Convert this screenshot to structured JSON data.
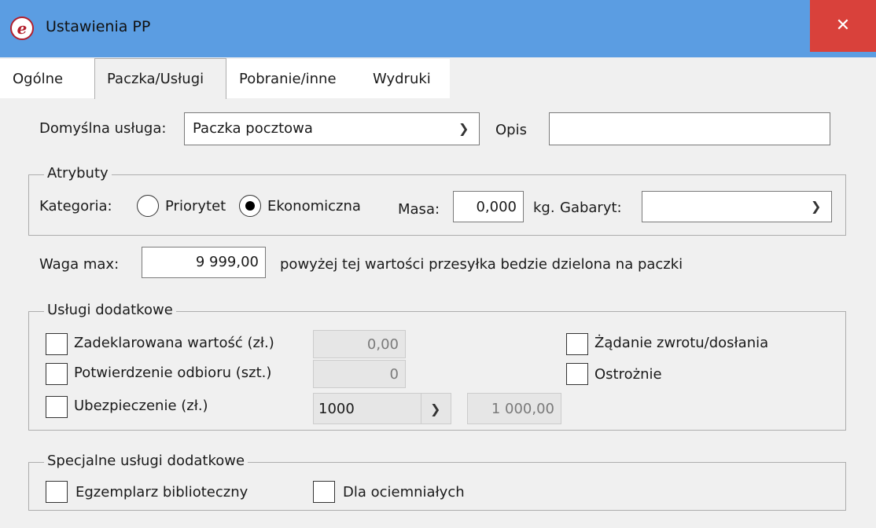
{
  "window": {
    "title": "Ustawienia PP",
    "close_glyph": "✕",
    "titlebar_color": "#5b9de2",
    "close_color": "#d9413b"
  },
  "tabs": [
    {
      "label": "Ogólne"
    },
    {
      "label": "Paczka/Usługi"
    },
    {
      "label": "Pobranie/inne"
    },
    {
      "label": "Wydruki"
    }
  ],
  "active_tab": "Paczka/Usługi",
  "main": {
    "default_service_label": "Domyślna usługa:",
    "default_service_value": "Paczka pocztowa",
    "description_label": "Opis",
    "description_value": ""
  },
  "attributes": {
    "legend": "Atrybuty",
    "category_label": "Kategoria:",
    "options": [
      "Priorytet",
      "Ekonomiczna"
    ],
    "selected": "Ekonomiczna",
    "mass_label": "Masa:",
    "mass_value": "0,000",
    "mass_unit": "kg.",
    "size_label": "Gabaryt:",
    "size_value": ""
  },
  "max_weight": {
    "label": "Waga max:",
    "value": "9 999,00",
    "note": "powyżej tej wartości przesyłka bedzie dzielona na paczki"
  },
  "additional_services": {
    "legend": "Usługi dodatkowe",
    "declared_value_label": "Zadeklarowana wartość (zł.)",
    "declared_value": "0,00",
    "receipt_confirmation_label": "Potwierdzenie odbioru (szt.)",
    "receipt_confirmation_value": "0",
    "insurance_label": "Ubezpieczenie (zł.)",
    "insurance_option": "1000",
    "insurance_amount": "1 000,00",
    "return_request_label": "Żądanie zwrotu/dosłania",
    "careful_label": "Ostrożnie"
  },
  "special_services": {
    "legend": "Specjalne usługi dodatkowe",
    "library_copy_label": "Egzemplarz biblioteczny",
    "blind_label": "Dla ociemniałych"
  },
  "icons": {
    "app": "app-logo-icon",
    "dropdown": "chevron-down-icon",
    "close": "close-icon"
  }
}
